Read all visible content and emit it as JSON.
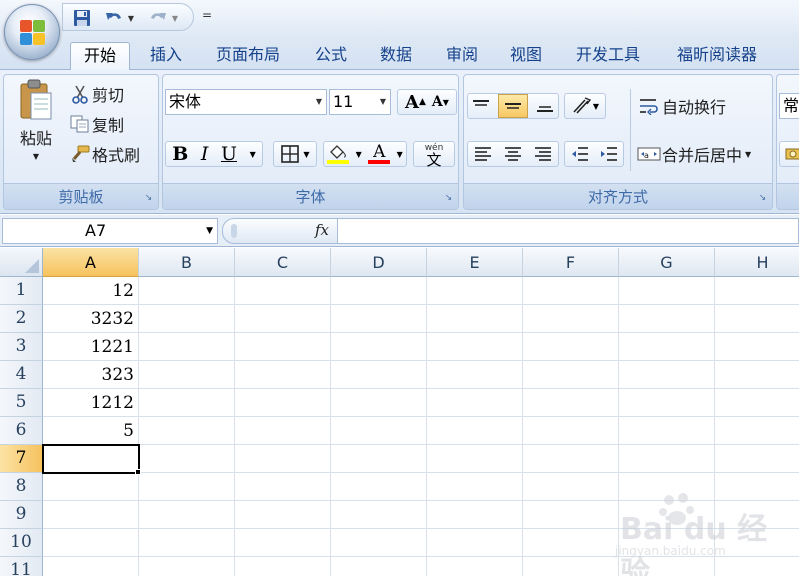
{
  "quick_access": {
    "more_label": "="
  },
  "tabs": [
    {
      "label": "开始",
      "active": true
    },
    {
      "label": "插入"
    },
    {
      "label": "页面布局"
    },
    {
      "label": "公式"
    },
    {
      "label": "数据"
    },
    {
      "label": "审阅"
    },
    {
      "label": "视图"
    },
    {
      "label": "开发工具"
    },
    {
      "label": "福昕阅读器"
    }
  ],
  "clipboard": {
    "group_label": "剪贴板",
    "paste_label": "粘贴",
    "cut_label": "剪切",
    "copy_label": "复制",
    "format_painter_label": "格式刷"
  },
  "font": {
    "group_label": "字体",
    "font_name": "宋体",
    "font_size": "11",
    "bold_label": "B",
    "italic_label": "I",
    "underline_label": "U",
    "grow_label": "A",
    "shrink_label": "A",
    "font_color_label": "A",
    "phonetic_label": "文",
    "phonetic_top": "wén",
    "highlight_color": "#ffff00",
    "font_color": "#ff0000"
  },
  "alignment": {
    "group_label": "对齐方式",
    "wrap_text_label": "自动换行",
    "merge_center_label": "合并后居中"
  },
  "number": {
    "format_partial": "常"
  },
  "formula_bar": {
    "name_box": "A7",
    "fx_label": "fx",
    "formula": ""
  },
  "grid": {
    "columns": [
      "A",
      "B",
      "C",
      "D",
      "E",
      "F",
      "G",
      "H"
    ],
    "selected_column": "A",
    "rows": [
      "1",
      "2",
      "3",
      "4",
      "5",
      "6",
      "7",
      "8",
      "9",
      "10",
      "11"
    ],
    "selected_row": "7",
    "column_a_values": [
      "12",
      "3232",
      "1221",
      "323",
      "1212",
      "5",
      "",
      "",
      "",
      "",
      ""
    ],
    "active_cell": "A7"
  },
  "watermark": {
    "brand": "Bai du 经验",
    "url": "jingyan.baidu.com"
  }
}
